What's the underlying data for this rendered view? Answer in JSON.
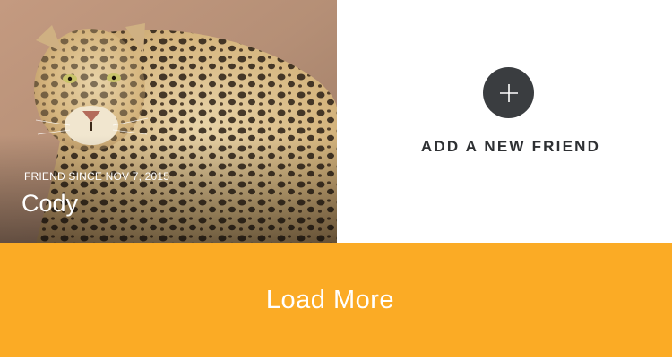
{
  "friends": [
    {
      "friend_since": "FRIEND SINCE NOV 7, 2015",
      "name": "Cody",
      "photo_icon": "leopard-photo"
    }
  ],
  "add_friend": {
    "icon": "plus-icon",
    "label": "ADD A NEW FRIEND"
  },
  "load_more": {
    "label": "Load More"
  },
  "colors": {
    "accent": "#fbab25",
    "add_circle": "#3a3d40",
    "add_label": "#2e3033",
    "background": "#ffffff"
  }
}
